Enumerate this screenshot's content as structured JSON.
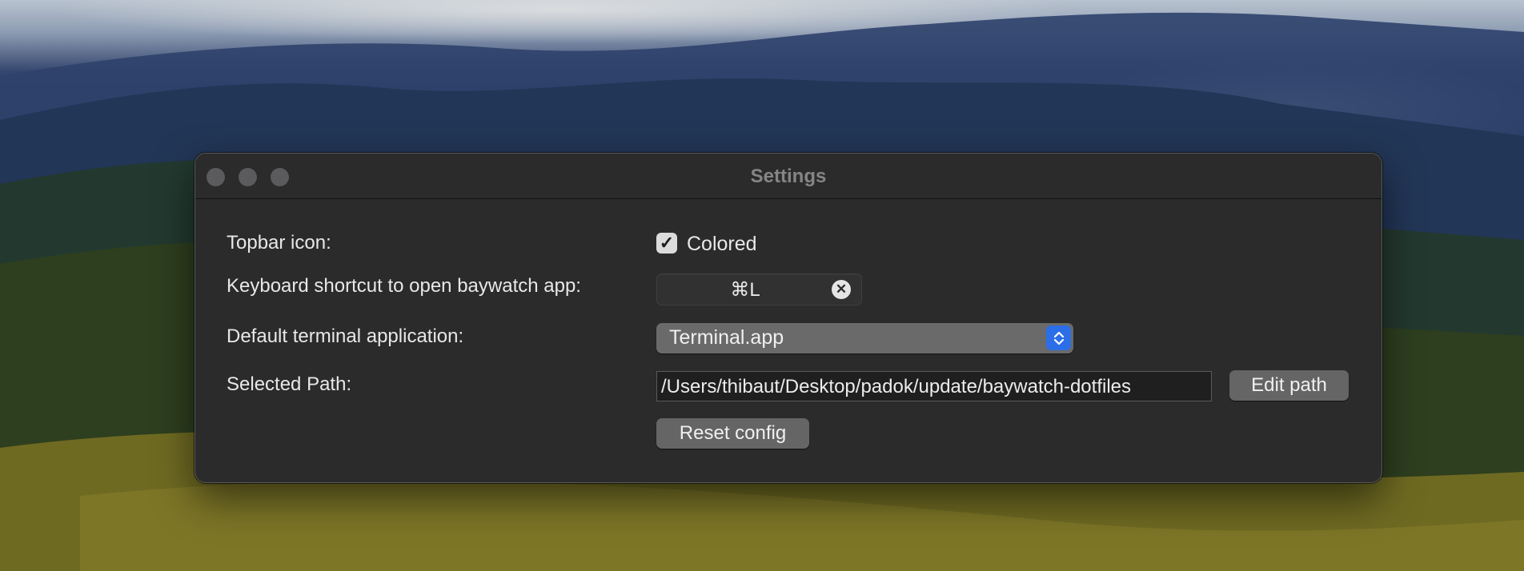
{
  "window": {
    "title": "Settings"
  },
  "settings": {
    "topbar_icon": {
      "label": "Topbar icon:",
      "checkbox_label": "Colored",
      "checked": true
    },
    "shortcut": {
      "label": "Keyboard shortcut to open baywatch app:",
      "value": "⌘L",
      "clear_icon": "x-circle-icon"
    },
    "terminal": {
      "label": "Default terminal application:",
      "selected": "Terminal.app",
      "arrows_icon": "chevron-up-down-icon"
    },
    "path": {
      "label": "Selected Path:",
      "value": "/Users/thibaut/Desktop/padok/update/baywatch-dotfiles",
      "edit_button": "Edit path"
    },
    "reset_button": "Reset config"
  },
  "colors": {
    "window_bg": "#2b2b2c",
    "accent": "#2b6ee8",
    "button_bg": "#656566"
  }
}
